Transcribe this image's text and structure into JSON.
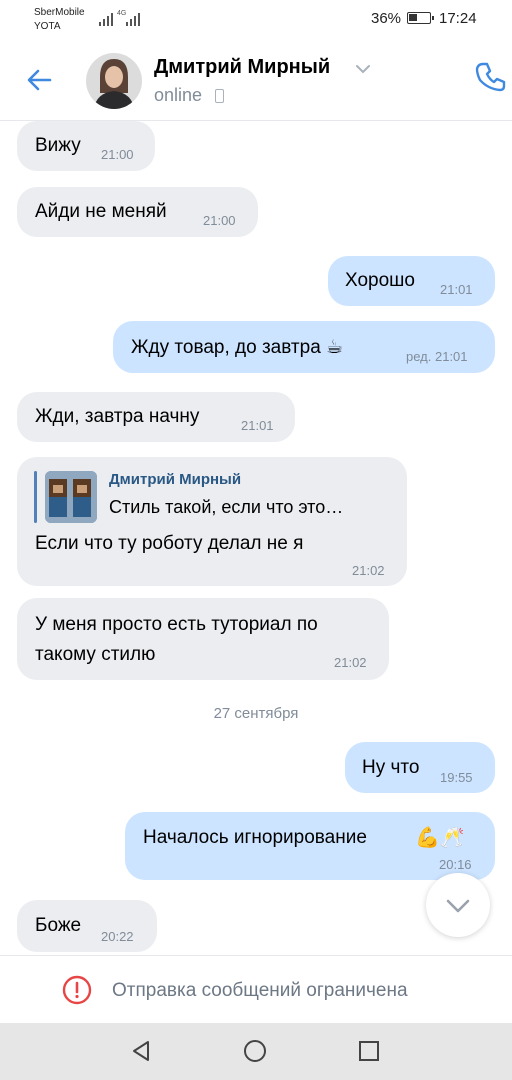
{
  "status_bar": {
    "carrier_line1": "SberMobile",
    "carrier_line2": "YOTA",
    "network": "4G",
    "battery": "36%",
    "time": "17:24"
  },
  "header": {
    "name": "Дмитрий Мирный",
    "status": "online"
  },
  "messages": [
    {
      "dir": "in",
      "text": "Вижу",
      "time": "21:00"
    },
    {
      "dir": "in",
      "text": "Айди не меняй",
      "time": "21:00"
    },
    {
      "dir": "out",
      "text": "Хорошо",
      "time": "21:01"
    },
    {
      "dir": "out",
      "text": "Жду товар, до завтра ☕",
      "time": "ред. 21:01"
    },
    {
      "dir": "in",
      "text": "Жди, завтра начну",
      "time": "21:01"
    },
    {
      "dir": "in",
      "reply_name": "Дмитрий Мирный",
      "reply_text": "Стиль такой, если что это…",
      "text": "Если что ту роботу делал не я",
      "time": "21:02"
    },
    {
      "dir": "in",
      "text_line1": "У меня просто есть туториал по",
      "text_line2": "такому стилю",
      "time": "21:02"
    },
    {
      "dir": "out",
      "text": "Ну что",
      "time": "19:55"
    },
    {
      "dir": "out",
      "text": "Началось игнорирование",
      "emoji": "💪🥂",
      "time": "20:16"
    },
    {
      "dir": "in",
      "text": "Боже",
      "time": "20:22"
    }
  ],
  "date_separator": "27 сентября",
  "restriction": {
    "text": "Отправка сообщений ограничена"
  },
  "icons": {
    "back": "back-arrow-icon",
    "call": "phone-icon",
    "scroll": "chevron-down-icon",
    "warning": "exclamation-circle-icon"
  },
  "colors": {
    "accent": "#3f8ae0",
    "incoming_bubble": "#ebedf0",
    "outgoing_bubble": "#cce4ff",
    "warning": "#e64646"
  }
}
